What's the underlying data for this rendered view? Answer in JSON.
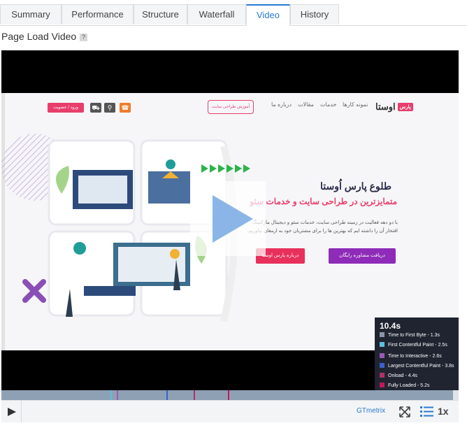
{
  "tabs": [
    {
      "label": "Summary",
      "active": false
    },
    {
      "label": "Performance",
      "active": false
    },
    {
      "label": "Structure",
      "active": false
    },
    {
      "label": "Waterfall",
      "active": false
    },
    {
      "label": "Video",
      "active": true
    },
    {
      "label": "History",
      "active": false
    }
  ],
  "page_title": "Page Load Video",
  "help_icon": "?",
  "site": {
    "logo": "اوستا",
    "logo_badge": "پارس",
    "nav": [
      "نمونه کارها",
      "خدمات",
      "مقالات",
      "درباره ما"
    ],
    "outline_button": "آموزش طراحی سایت",
    "login_button": "ورود / عضویت",
    "headline": "طلوع پارس اُوستا",
    "subheadline": "متمایزترین در طراحی سایت و خدمات سئو",
    "paragraph": "با دو دهه فعالیت در زمینه طراحی سایت، خدمات سئو و دیجیتال مارکتینگ افتخار آن را داشته ایم که بهترین ها را برای مشتریان خود به ارمغان بیاوریم.",
    "cta_primary": "دریافت مشاوره رایگان",
    "cta_secondary": "درباره پارس اوستا"
  },
  "stats": {
    "time": "10.4s",
    "items": [
      {
        "label": "Time to First Byte - 1.3s",
        "color": "#8a96a8"
      },
      {
        "label": "First Contentful Paint - 2.5s",
        "color": "#5bc0de"
      },
      {
        "label": "Time to Interactive - 2.6s",
        "color": "#9b59b6"
      },
      {
        "label": "Largest Contentful Paint - 3.8s",
        "color": "#3a5fcd"
      },
      {
        "label": "Onload - 4.4s",
        "color": "#b0306a"
      },
      {
        "label": "Fully Loaded - 5.2s",
        "color": "#c2185b"
      }
    ]
  },
  "controls": {
    "brand": "GTmetrix",
    "speed": "1x"
  },
  "icons": [
    "play-icon",
    "fullscreen-icon",
    "list-icon",
    "cart-icon",
    "search-icon",
    "phone-icon",
    "help-icon"
  ]
}
